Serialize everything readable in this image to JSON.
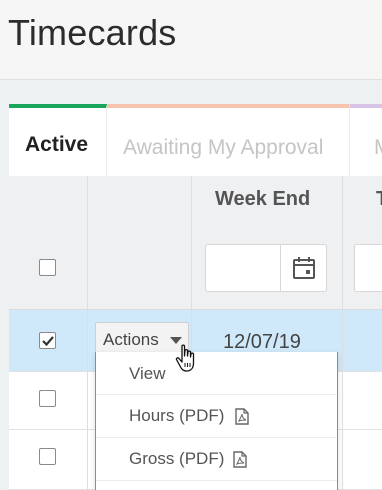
{
  "page": {
    "title": "Timecards"
  },
  "tabs": [
    {
      "label": "Active",
      "active": true,
      "accent": "#19a55b"
    },
    {
      "label": "Awaiting My Approval",
      "active": false,
      "accent": "#f7c4ad"
    },
    {
      "label": "M",
      "active": false,
      "accent": "#d7c3e6"
    }
  ],
  "table": {
    "columns": {
      "week_end": "Week End",
      "next": "T"
    },
    "filters": {
      "week_end_value": "",
      "calendar_icon": "calendar-icon"
    },
    "rows": [
      {
        "checked": true,
        "actions_label": "Actions",
        "week_end": "12/07/19",
        "selected_color": "#cfe9fb"
      },
      {
        "checked": false
      },
      {
        "checked": false
      }
    ]
  },
  "actions_menu": {
    "items": [
      {
        "label": "View"
      },
      {
        "label": "Hours (PDF)",
        "icon": "pdf-icon"
      },
      {
        "label": "Gross (PDF)",
        "icon": "pdf-icon"
      }
    ]
  }
}
